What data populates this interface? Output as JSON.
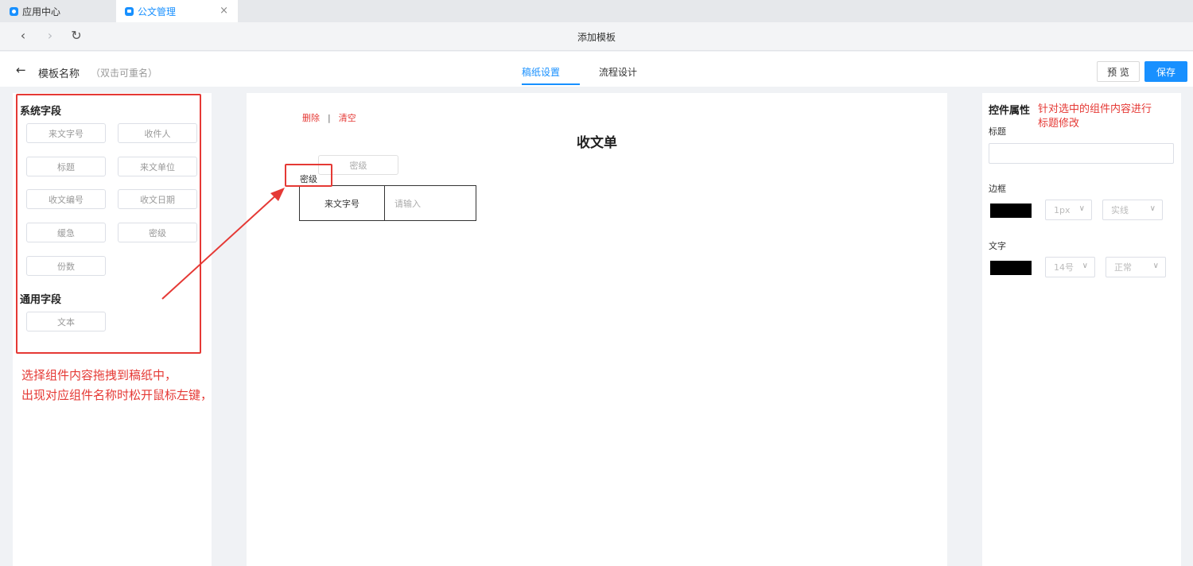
{
  "browser": {
    "tabs": [
      {
        "label": "应用中心",
        "icon": "app-center-icon"
      },
      {
        "label": "公文管理",
        "icon": "document-icon",
        "close": "×"
      }
    ],
    "nav": {
      "back": "‹",
      "forward": "›",
      "reload": "↻",
      "title": "添加模板"
    }
  },
  "header": {
    "back": "←",
    "name": "模板名称",
    "hint": "（双击可重名）",
    "tabs": [
      {
        "label": "稿纸设置",
        "active": true
      },
      {
        "label": "流程设计",
        "active": false
      }
    ],
    "preview": "预 览",
    "save": "保存"
  },
  "left": {
    "system_title": "系统字段",
    "system_fields": [
      "来文字号",
      "收件人",
      "标题",
      "来文单位",
      "收文编号",
      "收文日期",
      "缓急",
      "密级",
      "份数"
    ],
    "common_title": "通用字段",
    "common_fields": [
      "文本"
    ]
  },
  "canvas": {
    "delete": "删除",
    "separator": "|",
    "clear": "清空",
    "title": "收文单",
    "ghost_chip": "密级",
    "drag_label": "密级",
    "row": {
      "label": "来文字号",
      "placeholder": "请输入"
    }
  },
  "right": {
    "title": "控件属性",
    "title_label": "标题",
    "border_label": "边框",
    "border_width": "1px",
    "border_style": "实线",
    "text_label": "文字",
    "font_size": "14号",
    "font_weight": "正常",
    "border_color": "#000000",
    "text_color": "#000000"
  },
  "annotations": {
    "left_line1": "选择组件内容拖拽到稿纸中，",
    "left_line2": "出现对应组件名称时松开鼠标左键，",
    "right_line1": "针对选中的组件内容进行",
    "right_line2": "标题修改"
  },
  "colors": {
    "accent": "#1890ff",
    "annotation": "#e53935"
  }
}
